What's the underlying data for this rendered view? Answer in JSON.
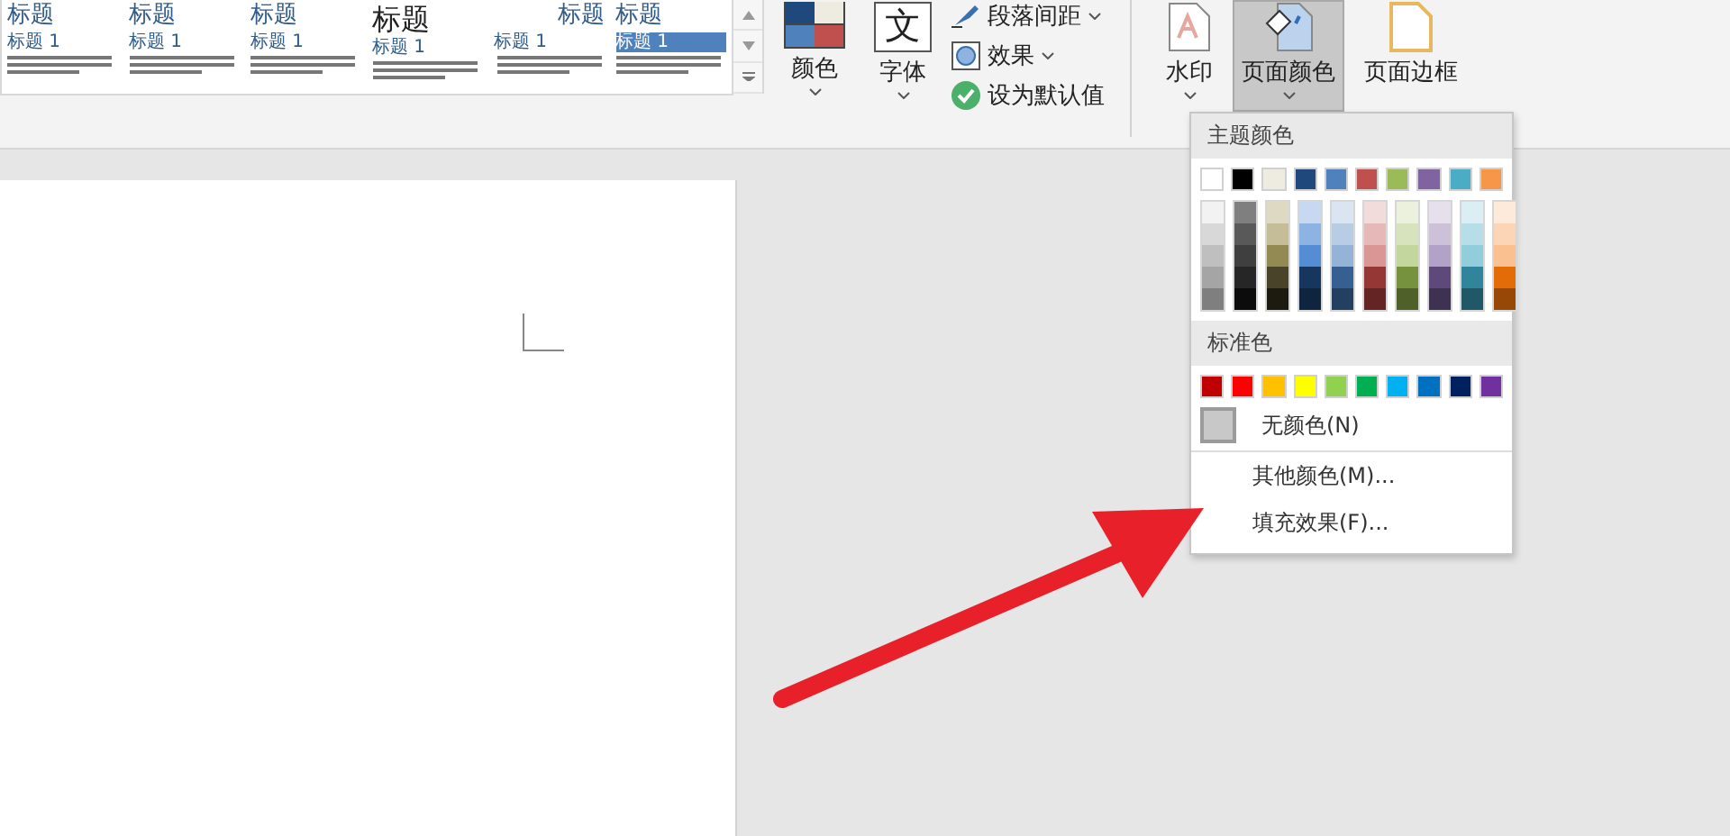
{
  "style_gallery": {
    "items": [
      {
        "title": "标题",
        "heading": "标题 1"
      },
      {
        "title": "标题",
        "heading": "标题 1"
      },
      {
        "title": "标题",
        "heading": "标题 1"
      },
      {
        "title": "标题",
        "heading": "标题 1"
      },
      {
        "title": "标题",
        "heading": "标题 1"
      },
      {
        "title": "标题",
        "heading": "标题 1"
      }
    ]
  },
  "document_format": {
    "large_buttons": [
      {
        "kind": "colors",
        "label": "颜色"
      },
      {
        "kind": "fonts",
        "label": "字体",
        "glyph": "文"
      }
    ],
    "small_buttons": [
      {
        "kind": "spacing",
        "label": "段落间距",
        "dropdown": true
      },
      {
        "kind": "effects",
        "label": "效果",
        "dropdown": true
      },
      {
        "kind": "default",
        "label": "设为默认值",
        "dropdown": false
      }
    ]
  },
  "page_background": [
    {
      "kind": "watermark",
      "label": "水印",
      "selected": false
    },
    {
      "kind": "page_color",
      "label": "页面颜色",
      "selected": true
    },
    {
      "kind": "page_border",
      "label": "页面边框",
      "selected": false
    }
  ],
  "color_menu": {
    "theme_label": "主题颜色",
    "theme_columns": [
      {
        "color": "#ffffff",
        "shades": [
          {
            "color": "#f2f2f2"
          },
          {
            "color": "#d8d8d8"
          },
          {
            "color": "#bfbfbf"
          },
          {
            "color": "#a5a5a5"
          },
          {
            "color": "#7f7f7f"
          }
        ]
      },
      {
        "color": "#000000",
        "shades": [
          {
            "color": "#7f7f7f"
          },
          {
            "color": "#595959"
          },
          {
            "color": "#3f3f3f"
          },
          {
            "color": "#262626"
          },
          {
            "color": "#0c0c0c"
          }
        ]
      },
      {
        "color": "#eeece1",
        "shades": [
          {
            "color": "#ddd9c3"
          },
          {
            "color": "#c4bd97"
          },
          {
            "color": "#938953"
          },
          {
            "color": "#494429"
          },
          {
            "color": "#1d1b10"
          }
        ]
      },
      {
        "color": "#1f497d",
        "shades": [
          {
            "color": "#c6d9f0"
          },
          {
            "color": "#8db3e2"
          },
          {
            "color": "#548dd4"
          },
          {
            "color": "#17365d"
          },
          {
            "color": "#0f243e"
          }
        ]
      },
      {
        "color": "#4f81bd",
        "shades": [
          {
            "color": "#dbe5f1"
          },
          {
            "color": "#b8cce4"
          },
          {
            "color": "#95b3d7"
          },
          {
            "color": "#366092"
          },
          {
            "color": "#244061"
          }
        ]
      },
      {
        "color": "#c0504d",
        "shades": [
          {
            "color": "#f2dcdb"
          },
          {
            "color": "#e5b9b7"
          },
          {
            "color": "#d99694"
          },
          {
            "color": "#953734"
          },
          {
            "color": "#632423"
          }
        ]
      },
      {
        "color": "#9bbb59",
        "shades": [
          {
            "color": "#ebf1dd"
          },
          {
            "color": "#d7e3bc"
          },
          {
            "color": "#c3d69b"
          },
          {
            "color": "#76923c"
          },
          {
            "color": "#4f6128"
          }
        ]
      },
      {
        "color": "#8064a2",
        "shades": [
          {
            "color": "#e5e0ec"
          },
          {
            "color": "#ccc1d9"
          },
          {
            "color": "#b2a2c7"
          },
          {
            "color": "#5f497a"
          },
          {
            "color": "#3f3151"
          }
        ]
      },
      {
        "color": "#4bacc6",
        "shades": [
          {
            "color": "#dbeef3"
          },
          {
            "color": "#b7dde8"
          },
          {
            "color": "#92cddc"
          },
          {
            "color": "#31859b"
          },
          {
            "color": "#205867"
          }
        ]
      },
      {
        "color": "#f79646",
        "shades": [
          {
            "color": "#fdeada"
          },
          {
            "color": "#fbd5b5"
          },
          {
            "color": "#fac08f"
          },
          {
            "color": "#e36c09"
          },
          {
            "color": "#974806"
          }
        ]
      }
    ],
    "standard_label": "标准色",
    "standard_colors": [
      {
        "color": "#c00000"
      },
      {
        "color": "#ff0000"
      },
      {
        "color": "#ffc000"
      },
      {
        "color": "#ffff00"
      },
      {
        "color": "#92d050"
      },
      {
        "color": "#00b050"
      },
      {
        "color": "#00b0f0"
      },
      {
        "color": "#0070c0"
      },
      {
        "color": "#002060"
      },
      {
        "color": "#7030a0"
      }
    ],
    "no_color": "无颜色(N)",
    "items": [
      "其他颜色(M)...",
      "填充效果(F)..."
    ]
  }
}
